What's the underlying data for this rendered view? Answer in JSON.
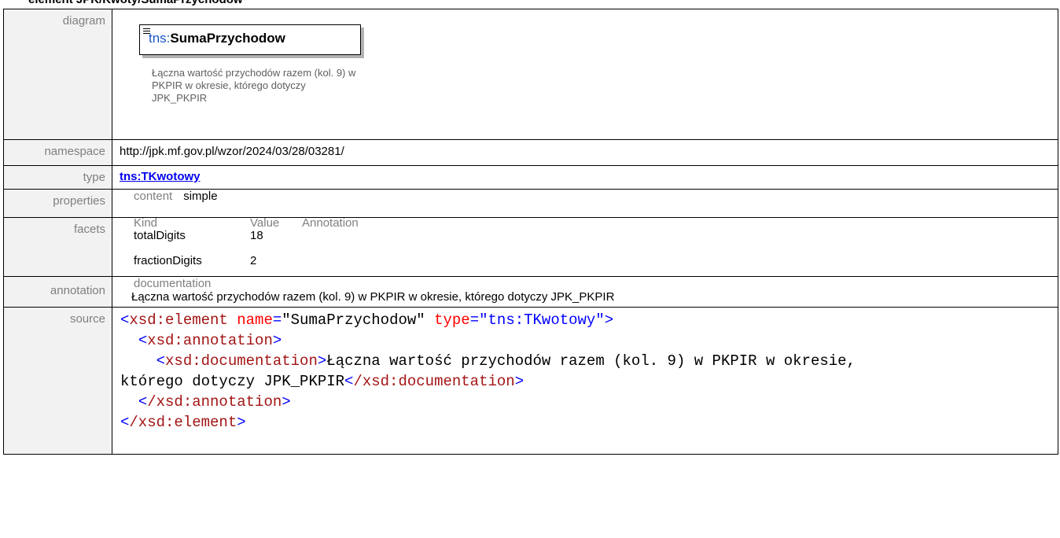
{
  "heading": "element JPK/Kwoty/SumaPrzychodow",
  "rows": {
    "diagram": {
      "label": "diagram",
      "prefix": "tns:",
      "name": "SumaPrzychodow",
      "description": "Łączna wartość przychodów razem (kol. 9) w PKPIR w okresie, którego dotyczy JPK_PKPIR"
    },
    "namespace": {
      "label": "namespace",
      "value": "http://jpk.mf.gov.pl/wzor/2024/03/28/03281/"
    },
    "type": {
      "label": "type",
      "value": "tns:TKwotowy"
    },
    "properties": {
      "label": "properties",
      "key": "content",
      "value": "simple"
    },
    "facets": {
      "label": "facets",
      "headers": [
        "Kind",
        "Value",
        "Annotation"
      ],
      "items": [
        {
          "kind": "totalDigits",
          "value": "18"
        },
        {
          "kind": "fractionDigits",
          "value": "2"
        }
      ]
    },
    "annotation": {
      "label": "annotation",
      "key": "documentation",
      "value": "Łączna wartość przychodów razem (kol. 9) w PKPIR w okresie, którego dotyczy JPK_PKPIR"
    },
    "source": {
      "label": "source",
      "l1_open": "<",
      "l1_tag": "xsd:element",
      "l1_attr1": "name",
      "l1_eq1": "=",
      "l1_val1": "\"SumaPrzychodow\"",
      "l1_attr2": "type",
      "l1_eq2": "=",
      "l1_val2": "\"tns:TKwotowy\"",
      "l1_close": ">",
      "l2_tag": "xsd:annotation",
      "l3_tag": "xsd:documentation",
      "l3_text": "Łączna wartość przychodów razem (kol. 9) w PKPIR w okresie,",
      "l4_text": "którego dotyczy JPK_PKPIR",
      "l4_tag": "/xsd:documentation",
      "l5_tag": "/xsd:annotation",
      "l6_tag": "/xsd:element"
    }
  }
}
